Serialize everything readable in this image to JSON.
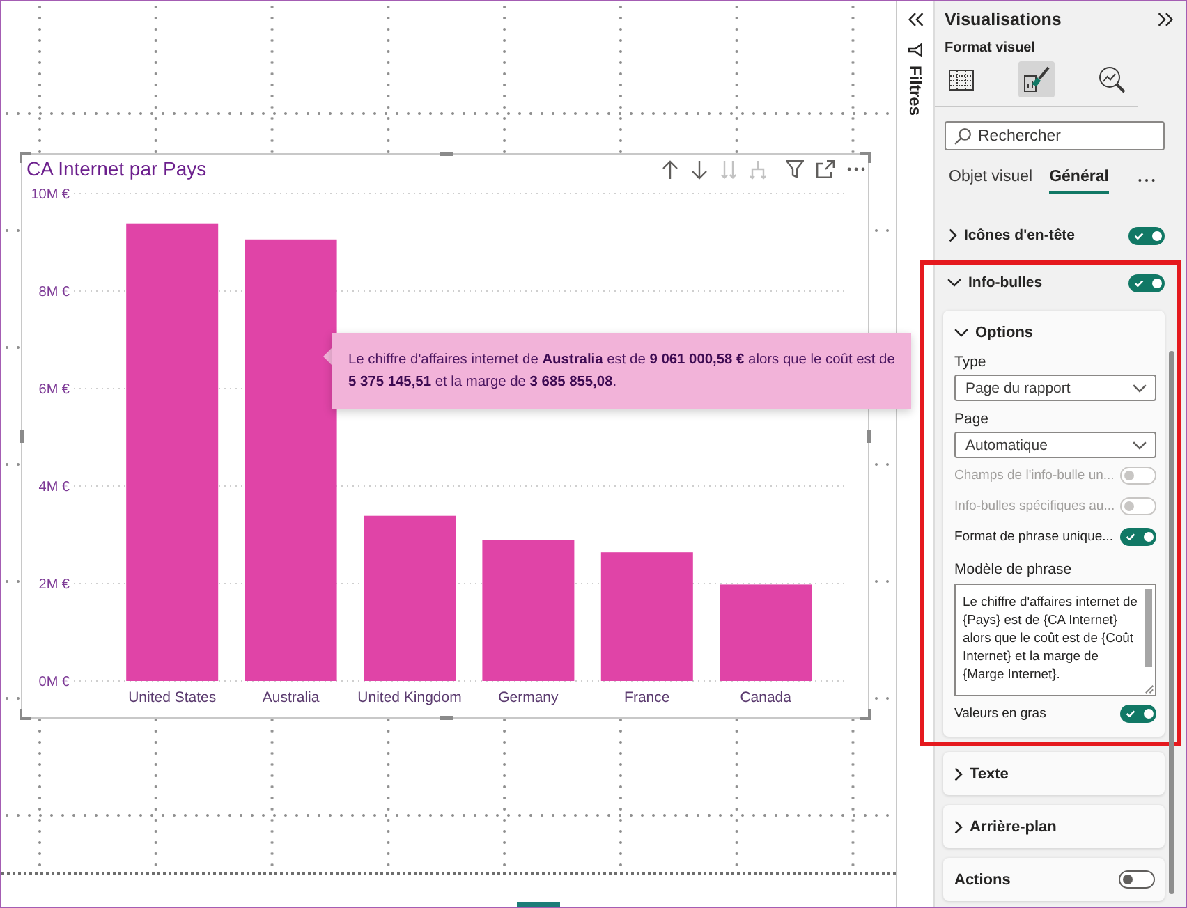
{
  "canvas": {
    "visual": {
      "title": "CA Internet par Pays",
      "header_buttons": [
        {
          "kind": "drill-up",
          "disabled": false
        },
        {
          "kind": "drill-down",
          "disabled": false
        },
        {
          "kind": "next-level",
          "disabled": true
        },
        {
          "kind": "expand-level",
          "disabled": true
        },
        {
          "kind": "filter",
          "disabled": false
        },
        {
          "kind": "focus",
          "disabled": false
        },
        {
          "kind": "more",
          "disabled": false
        }
      ],
      "chart_data": {
        "type": "bar",
        "categories": [
          "United States",
          "Australia",
          "United Kingdom",
          "Germany",
          "France",
          "Canada"
        ],
        "values": [
          9.39,
          9.06,
          3.39,
          2.89,
          2.64,
          1.98
        ],
        "ylim": [
          0,
          10
        ],
        "yticks": [
          {
            "value": 0,
            "label": "0M €"
          },
          {
            "value": 2,
            "label": "2M €"
          },
          {
            "value": 4,
            "label": "4M €"
          },
          {
            "value": 6,
            "label": "6M €"
          },
          {
            "value": 8,
            "label": "8M €"
          },
          {
            "value": 10,
            "label": "10M €"
          }
        ],
        "grid": true
      },
      "tooltip": {
        "text": "Le chiffre d'affaires internet de **Australia** est de **9 061 000,58 €** alors que le coût est de **5 375 145,51** et la marge de **3 685 855,08**."
      }
    }
  },
  "filters_pane": {
    "title": "Filtres"
  },
  "visualizations_pane": {
    "title": "Visualisations",
    "subtitle": "Format visuel",
    "view_buttons": [
      {
        "kind": "fields",
        "selected": false
      },
      {
        "kind": "format",
        "selected": true
      },
      {
        "kind": "analytics",
        "selected": false
      }
    ],
    "search": {
      "placeholder": "Rechercher"
    },
    "tabs": [
      {
        "label": "Objet visuel",
        "selected": false
      },
      {
        "label": "Général",
        "selected": true
      }
    ],
    "groups": [
      {
        "title": "Icônes d'en-tête",
        "expanded": false,
        "on": true,
        "highlighted": false
      },
      {
        "title": "Info-bulles",
        "expanded": true,
        "on": true,
        "highlighted": true,
        "cards": [
          {
            "kind": "section",
            "title": "Options",
            "expanded": true,
            "highlighted": true,
            "rows": [
              {
                "kind": "dropdown",
                "label": "Type",
                "value": "Page du rapport"
              },
              {
                "kind": "dropdown",
                "label": "Page",
                "value": "Automatique"
              },
              {
                "kind": "toggle",
                "label": "Champs de l'info-bulle un...",
                "on": false,
                "disabled": true
              },
              {
                "kind": "toggle",
                "label": "Info-bulles spécifiques au...",
                "on": false,
                "disabled": true
              },
              {
                "kind": "toggle",
                "label": "Format de phrase unique...",
                "on": true,
                "disabled": false
              },
              {
                "kind": "textarea",
                "label": "Modèle de phrase",
                "value": "Le chiffre d'affaires internet de {Pays} est de {CA Internet} alors que le coût est de {Coût Internet} et la marge de {Marge Internet}."
              },
              {
                "kind": "toggle",
                "label": "Valeurs en gras",
                "on": true,
                "disabled": false
              }
            ]
          },
          {
            "kind": "section",
            "title": "Texte",
            "expanded": false,
            "highlighted": false
          },
          {
            "kind": "section",
            "title": "Arrière-plan",
            "expanded": false,
            "highlighted": false
          },
          {
            "kind": "toggle",
            "title": "Actions",
            "on": false,
            "highlighted": false
          }
        ]
      }
    ]
  }
}
